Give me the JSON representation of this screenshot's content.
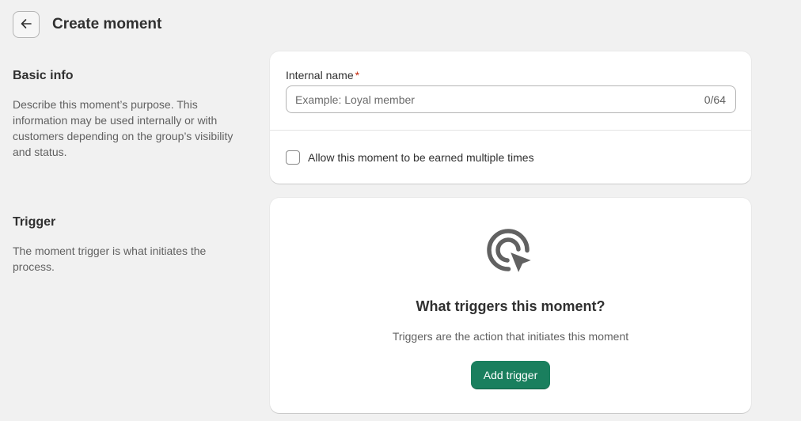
{
  "header": {
    "back_icon": "arrow-left-icon",
    "title": "Create moment"
  },
  "basic_info": {
    "title": "Basic info",
    "description": "Describe this moment’s purpose. This information may be used internally or with customers depending on the group’s visibility and status.",
    "internal_name": {
      "label": "Internal name",
      "required_marker": "*",
      "value": "",
      "placeholder": "Example: Loyal member",
      "char_count": "0/64"
    },
    "allow_multiple": {
      "label": "Allow this moment to be earned multiple times",
      "checked": false
    }
  },
  "trigger": {
    "title": "Trigger",
    "description": "The moment trigger is what initiates the process.",
    "empty_state": {
      "icon": "target-cursor-icon",
      "heading": "What triggers this moment?",
      "description": "Triggers are the action that initiates this moment",
      "button_label": "Add trigger"
    }
  },
  "colors": {
    "background": "#f1f1f1",
    "card": "#ffffff",
    "primary_button": "#1a7f5e",
    "required": "#c4290c"
  }
}
